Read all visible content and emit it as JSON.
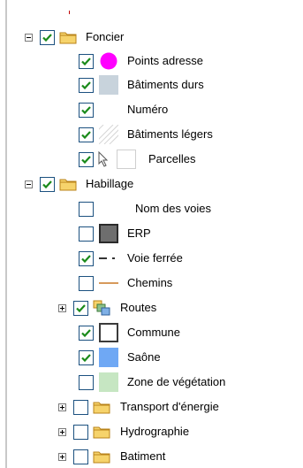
{
  "tree": {
    "groups": [
      {
        "label": "Foncier",
        "expanded": true,
        "checked": true,
        "layers": [
          {
            "label": "Points adresse",
            "checked": true,
            "symbol": "magenta-dot"
          },
          {
            "label": "Bâtiments durs",
            "checked": true,
            "symbol": "gray-fill"
          },
          {
            "label": "Numéro",
            "checked": true,
            "symbol": "none"
          },
          {
            "label": "Bâtiments légers",
            "checked": true,
            "symbol": "hatched-fill"
          },
          {
            "label": "Parcelles",
            "checked": true,
            "symbol": "cursor-and-white-box"
          }
        ]
      },
      {
        "label": "Habillage",
        "expanded": true,
        "checked": true,
        "layers": [
          {
            "label": "Nom des voies",
            "checked": false,
            "symbol": "none"
          },
          {
            "label": "ERP",
            "checked": false,
            "symbol": "dark-gray-box"
          },
          {
            "label": "Voie ferrée",
            "checked": true,
            "symbol": "dash-dot-line"
          },
          {
            "label": "Chemins",
            "checked": false,
            "symbol": "orange-line"
          },
          {
            "label": "Routes",
            "checked": true,
            "symbol": "multi-layer-icon",
            "expandable": true
          },
          {
            "label": "Commune",
            "checked": true,
            "symbol": "outlined-box"
          },
          {
            "label": "Saône",
            "checked": true,
            "symbol": "blue-fill"
          },
          {
            "label": "Zone de végétation",
            "checked": false,
            "symbol": "light-green-fill"
          },
          {
            "label": "Transport d'énergie",
            "checked": false,
            "symbol": "folder",
            "expandable": true
          },
          {
            "label": "Hydrographie",
            "checked": false,
            "symbol": "folder",
            "expandable": true
          },
          {
            "label": "Batiment",
            "checked": false,
            "symbol": "folder",
            "expandable": true
          }
        ]
      }
    ]
  },
  "colors": {
    "check": "#1a8a1a",
    "magenta": "#ff00ff",
    "folder_fill": "#f6d36b",
    "folder_border": "#b9831a",
    "bati_dur": "#c8d3dc",
    "erp": "#6e6e6e",
    "orange": "#d79a5b",
    "saone": "#6fa8f4",
    "vegetation": "#c6e6c2"
  }
}
